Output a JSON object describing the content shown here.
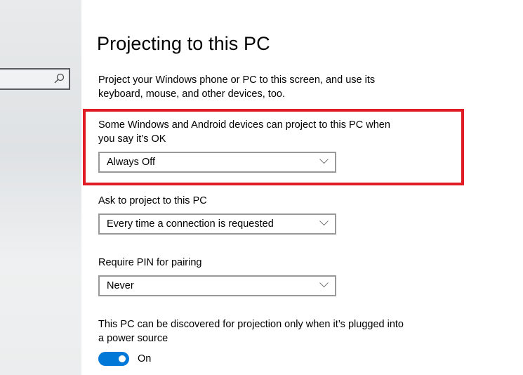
{
  "sidebar": {
    "search": {
      "value": "",
      "placeholder": "",
      "icon": "search-icon"
    }
  },
  "page": {
    "title": "Projecting to this PC",
    "description": "Project your Windows phone or PC to this screen, and use its keyboard, mouse, and other devices, too."
  },
  "settings": {
    "availability": {
      "label": "Some Windows and Android devices can project to this PC when you say it’s OK",
      "selected": "Always Off",
      "highlighted": true,
      "highlight_color": "#e01b24"
    },
    "ask_to_project": {
      "label": "Ask to project to this PC",
      "selected": "Every time a connection is requested"
    },
    "require_pin": {
      "label": "Require PIN for pairing",
      "selected": "Never"
    },
    "power_source": {
      "label": "This PC can be discovered for projection only when it’s plugged into a power source",
      "toggle_state": "On",
      "toggle_on": true,
      "accent_color": "#0078d7"
    }
  }
}
